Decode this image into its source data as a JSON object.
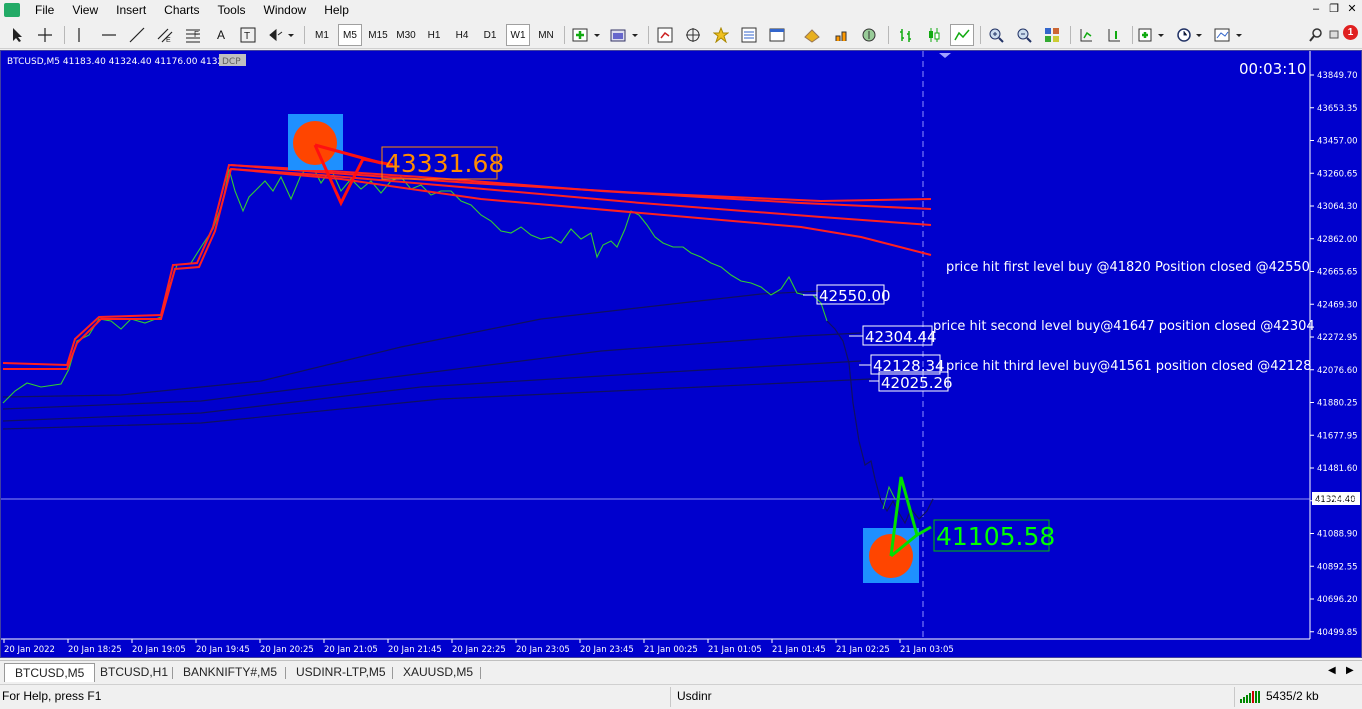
{
  "menu": [
    "File",
    "View",
    "Insert",
    "Charts",
    "Tools",
    "Window",
    "Help"
  ],
  "toolbar": {
    "timeframes": [
      "M1",
      "M5",
      "M15",
      "M30",
      "H1",
      "H4",
      "D1",
      "W1",
      "MN"
    ],
    "selected_timeframe": "M5"
  },
  "notification_count": "1",
  "chart": {
    "header": "BTCUSD,M5  41183.40 41324.40 41176.00 41324",
    "indicator_badge": "DCP",
    "timer": "00:03:10",
    "current_price_label": "41324.40",
    "price_axis": [
      "43849.70",
      "43653.35",
      "43457.00",
      "43260.65",
      "43064.30",
      "42862.00",
      "42665.65",
      "42469.30",
      "42272.95",
      "42076.60",
      "41880.25",
      "41677.95",
      "41481.60",
      "41285.25",
      "41088.90",
      "40892.55",
      "40696.20",
      "40499.85"
    ],
    "time_axis": [
      "20 Jan 2022",
      "20 Jan 18:25",
      "20 Jan 19:05",
      "20 Jan 19:45",
      "20 Jan 20:25",
      "20 Jan 21:05",
      "20 Jan 21:45",
      "20 Jan 22:25",
      "20 Jan 23:05",
      "20 Jan 23:45",
      "21 Jan 00:25",
      "21 Jan 01:05",
      "21 Jan 01:45",
      "21 Jan 02:25",
      "21 Jan 03:05"
    ],
    "high_label": "43331.68",
    "low_label": "41105.58",
    "level_labels": [
      "42550.00",
      "42304.44",
      "42128.34",
      "42025.26"
    ],
    "annotations": [
      "price hit first level buy @41820 Position closed @42550",
      "price hit second level buy@41647 position closed @42304",
      "price hit third level buy@41561 position closed @42128"
    ],
    "colors": {
      "background": "#0000cd",
      "ma_lines": "#ff2020",
      "price_line": "#32cd32",
      "high_label": "#ff8c00",
      "low_label": "#00ff00"
    }
  },
  "tabs": [
    "BTCUSD,M5",
    "BTCUSD,H1",
    "BANKNIFTY#,M5",
    "USDINR-LTP,M5",
    "XAUUSD,M5"
  ],
  "active_tab": "BTCUSD,M5",
  "status": {
    "help": "For Help, press F1",
    "profile": "Usdinr",
    "traffic": "5435/2 kb"
  }
}
